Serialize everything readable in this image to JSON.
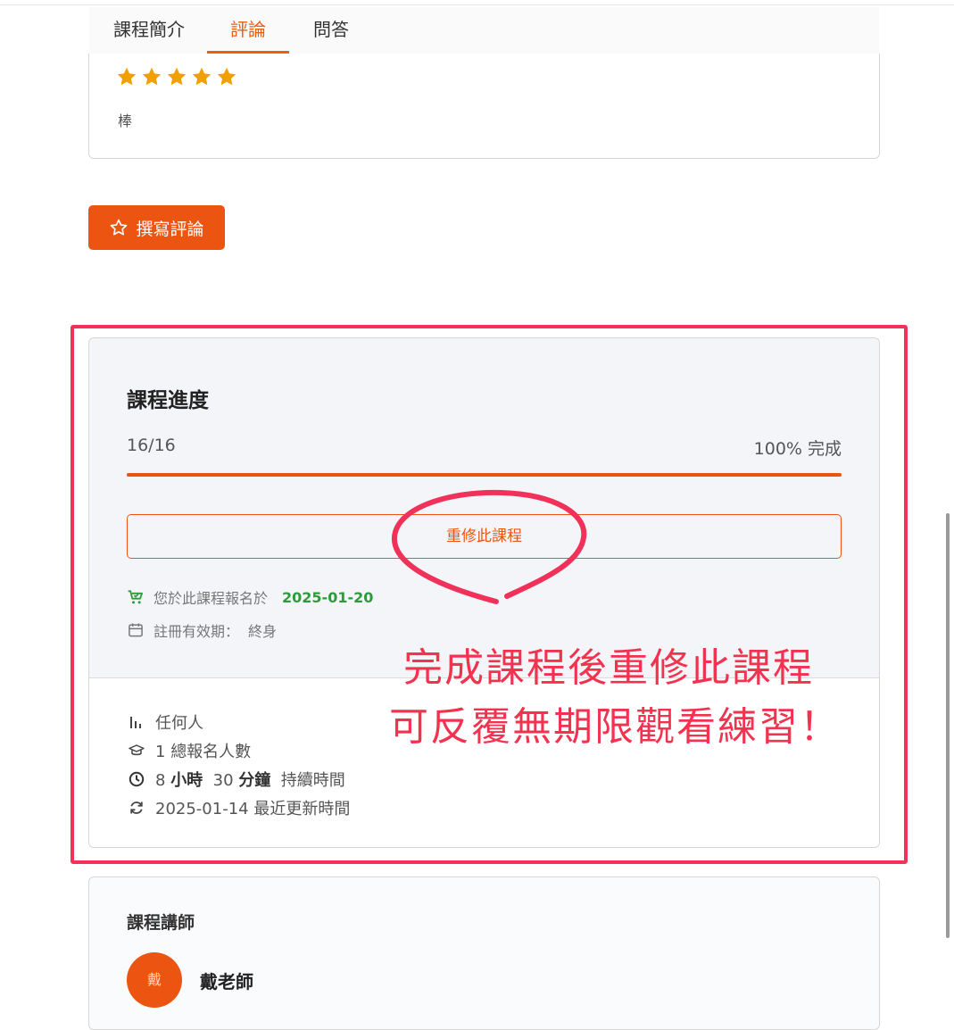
{
  "tabs": [
    {
      "label": "課程簡介",
      "active": false
    },
    {
      "label": "評論",
      "active": true
    },
    {
      "label": "問答",
      "active": false
    }
  ],
  "review": {
    "rating": 5,
    "max_rating": 5,
    "text": "棒"
  },
  "write_review_button": {
    "label": "撰寫評論",
    "icon": "star-outline-icon"
  },
  "progress": {
    "title": "課程進度",
    "count": "16/16",
    "percent_label": "100% 完成",
    "fraction": 1.0,
    "retake_label": "重修此課程",
    "enrolled_label": "您於此課程報名於",
    "enrolled_date": "2025-01-20",
    "validity_label": "註冊有效期：",
    "validity_value": "終身"
  },
  "stats": {
    "audience": "任何人",
    "enroll_count": "1",
    "enroll_label": "總報名人數",
    "duration_hours": "8",
    "hours_unit": "小時",
    "duration_minutes": "30",
    "minutes_unit": "分鐘",
    "duration_label": "持續時間",
    "updated_date": "2025-01-14",
    "updated_label": "最近更新時間"
  },
  "annotation": {
    "line1": "完成課程後重修此課程",
    "line2": "可反覆無期限觀看練習！"
  },
  "instructor": {
    "heading": "課程講師",
    "avatar_text": "戴",
    "name": "戴老師"
  },
  "colors": {
    "accent": "#ec5511",
    "annotation": "#f0325a",
    "success": "#2e9b3a",
    "star": "#f0a000"
  }
}
